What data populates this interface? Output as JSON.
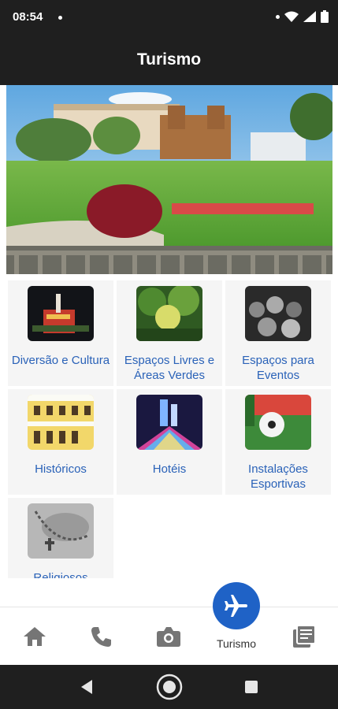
{
  "status_bar": {
    "time": "08:54"
  },
  "app_bar": {
    "title": "Turismo"
  },
  "categories": [
    {
      "label": "Diversão e Cultura",
      "icon": "night-building-photo"
    },
    {
      "label": "Espaços Livres e Áreas Verdes",
      "icon": "trees-photo"
    },
    {
      "label": "Espaços para Eventos",
      "icon": "crowd-photo"
    },
    {
      "label": "Históricos",
      "icon": "historic-facade-photo"
    },
    {
      "label": "Hotéis",
      "icon": "city-lights-photo"
    },
    {
      "label": "Instalações Esportivas",
      "icon": "soccer-ball-photo"
    },
    {
      "label": "Religiosos",
      "icon": "rosary-photo"
    }
  ],
  "bottom_nav": {
    "items": [
      {
        "icon": "home-icon"
      },
      {
        "icon": "phone-icon"
      },
      {
        "icon": "camera-icon"
      },
      {
        "icon": "airplane-icon",
        "label": "Turismo",
        "active": true
      },
      {
        "icon": "news-icon"
      }
    ],
    "accent_color": "#1f62c6"
  },
  "colors": {
    "bar": "#1f1f1f",
    "link_text": "#2a62b8",
    "tile_bg": "#f5f5f5"
  }
}
